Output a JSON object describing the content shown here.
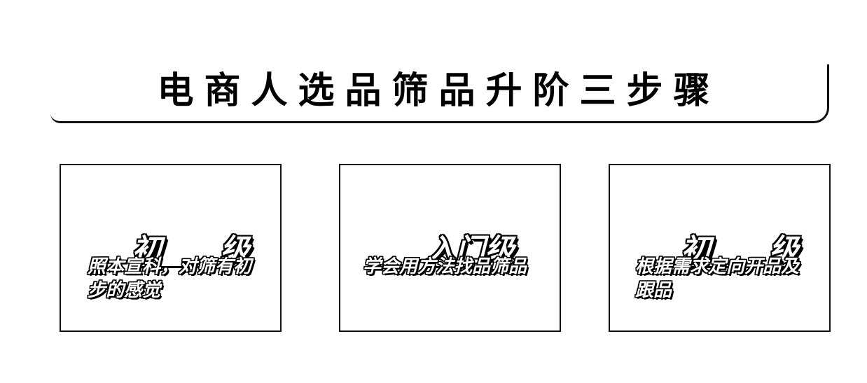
{
  "title": "电商人选品筛品升阶三步骤",
  "cards": [
    {
      "heading": "初　　级",
      "text": "照本宣科，对筛有初步的感觉"
    },
    {
      "heading": "入门级",
      "text": "学会用方法找品筛品"
    },
    {
      "heading": "初　　级",
      "text": "根据需求定向开品及跟品"
    }
  ]
}
